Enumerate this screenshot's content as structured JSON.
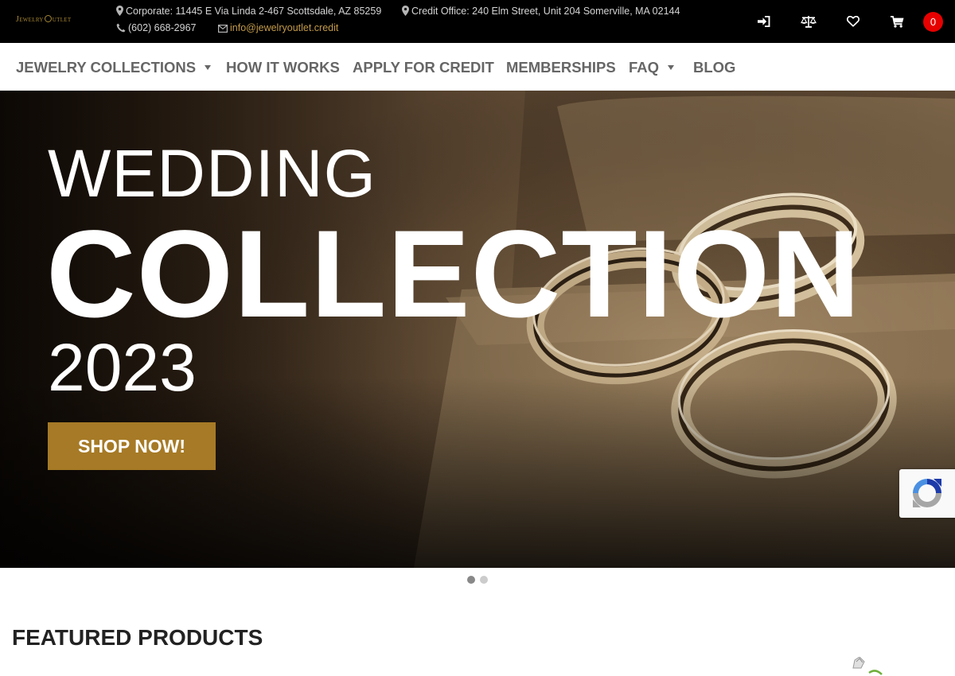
{
  "topbar": {
    "logo_text": "Jewelry Outlet",
    "corporate": "Corporate: 11445 E Via Linda 2-467 Scottsdale, AZ 85259",
    "credit_office": "Credit Office: 240 Elm Street, Unit 204 Somerville, MA 02144",
    "phone": "(602) 668-2967",
    "email": "info@jewelryoutlet.credit",
    "cart_count": "0",
    "icons": [
      "sign-in-icon",
      "compare-scale-icon",
      "heart-icon",
      "shopping-cart-icon"
    ]
  },
  "nav": {
    "items": [
      {
        "label": "JEWELRY COLLECTIONS",
        "has_dropdown": true
      },
      {
        "label": "HOW IT WORKS",
        "has_dropdown": false
      },
      {
        "label": "APPLY FOR CREDIT",
        "has_dropdown": false
      },
      {
        "label": "MEMBERSHIPS",
        "has_dropdown": false
      },
      {
        "label": "FAQ",
        "has_dropdown": true
      },
      {
        "label": "BLOG",
        "has_dropdown": false
      }
    ]
  },
  "hero": {
    "line1": "WEDDING",
    "line2": "COLLECTION",
    "line3": "2023",
    "cta": "SHOP NOW!",
    "slide_count": 2,
    "active_slide": 1
  },
  "featured": {
    "title": "FEATURED PRODUCTS"
  },
  "colors": {
    "topbar_bg": "#000000",
    "accent_gold": "#a67a26",
    "link_gold": "#c39a4a",
    "nav_text": "#666666",
    "cart_badge": "#e60000"
  }
}
